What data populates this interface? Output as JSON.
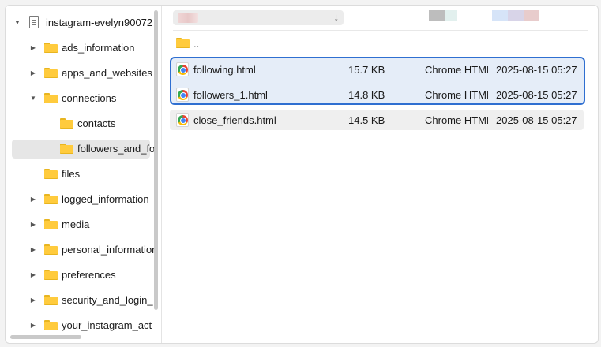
{
  "tree": {
    "root_label": "instagram-evelyn90072",
    "items": [
      {
        "label": "ads_information"
      },
      {
        "label": "apps_and_websites"
      },
      {
        "label": "connections"
      },
      {
        "label": "contacts"
      },
      {
        "label": "followers_and_fo"
      },
      {
        "label": "files"
      },
      {
        "label": "logged_information"
      },
      {
        "label": "media"
      },
      {
        "label": "personal_information"
      },
      {
        "label": "preferences"
      },
      {
        "label": "security_and_login_"
      },
      {
        "label": "your_instagram_act"
      }
    ]
  },
  "pathbar": {
    "dropdown_icon": "arrow-down-icon"
  },
  "files": {
    "parent_label": "..",
    "rows": [
      {
        "name": "following.html",
        "size": "15.7 KB",
        "type": "Chrome HTML Document",
        "date": "2025-08-15 05:27"
      },
      {
        "name": "followers_1.html",
        "size": "14.8 KB",
        "type": "Chrome HTML Document",
        "date": "2025-08-15 05:27"
      },
      {
        "name": "close_friends.html",
        "size": "14.5 KB",
        "type": "Chrome HTML Document",
        "date": "2025-08-15 05:27"
      }
    ]
  },
  "colors": {
    "selection_border": "#2f6fd1",
    "selection_fill": "#e5edf8",
    "folder": "#ffcb3d"
  }
}
